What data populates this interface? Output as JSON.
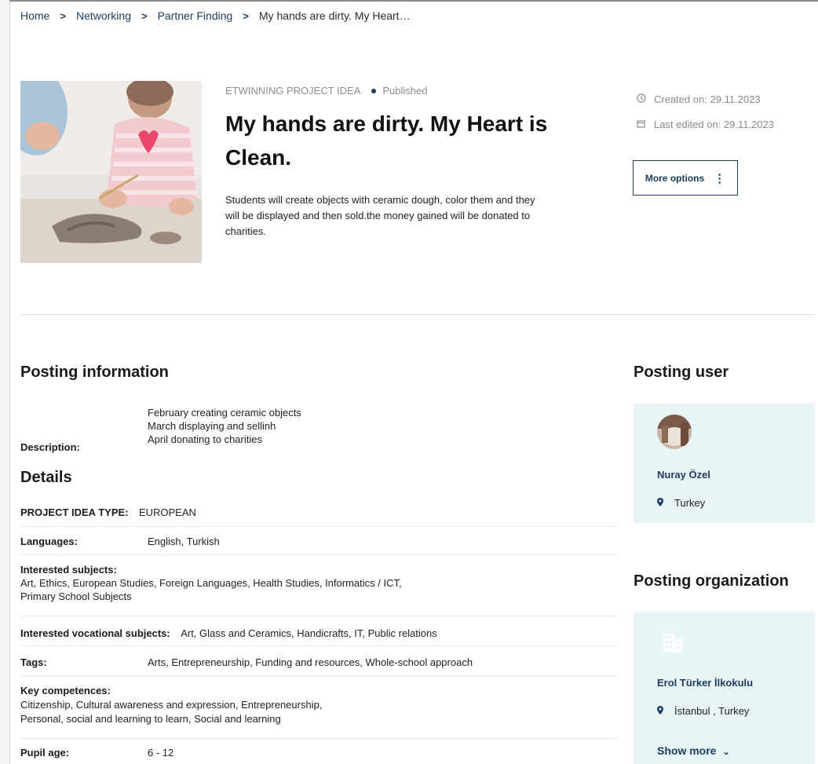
{
  "breadcrumb": {
    "items": [
      "Home",
      "Networking",
      "Partner Finding"
    ],
    "current": "My hands are dirty. My Heart…",
    "separator": ">"
  },
  "hero": {
    "kicker": "ETWINNING PROJECT IDEA",
    "status": "Published",
    "title": "My hands are dirty. My Heart is Clean.",
    "summary": "Students will create objects with ceramic dough, color them and they will be displayed and then sold.the money gained will be donated to charities."
  },
  "meta": {
    "created": "Created on: 29.11.2023",
    "edited": "Last edited on: 29.11.2023",
    "more_options": "More options"
  },
  "posting_info": {
    "heading": "Posting information",
    "description_label": "Description:",
    "description_lines": [
      "February creating ceramic objects",
      "March displaying and sellinh",
      "April donating to charities"
    ]
  },
  "details": {
    "heading": "Details",
    "project_idea_type_label": "PROJECT IDEA TYPE:",
    "project_idea_type": "EUROPEAN",
    "languages_label": "Languages:",
    "languages": "English, Turkish",
    "interested_subjects_label": "Interested subjects:",
    "interested_subjects_line1": "Art, Ethics, European Studies, Foreign Languages, Health Studies, Informatics / ICT,",
    "interested_subjects_line2": "Primary School Subjects",
    "vocational_label": "Interested vocational subjects:",
    "vocational": "Art, Glass and Ceramics, Handicrafts, IT, Public relations",
    "tags_label": "Tags:",
    "tags": "Arts, Entrepreneurship, Funding and resources, Whole-school approach",
    "key_competences_label": "Key competences:",
    "key_competences_line1": "Citizenship, Cultural awareness and expression, Entrepreneurship,",
    "key_competences_line2": "Personal, social and learning to learn, Social and learning",
    "pupil_age_label": "Pupil age:",
    "pupil_age": "6 - 12"
  },
  "posting_user": {
    "heading": "Posting user",
    "name": "Nuray Özel",
    "location": "Turkey"
  },
  "posting_org": {
    "heading": "Posting organization",
    "name": "Erol Türker İlkokulu",
    "location": "İstanbul , Turkey",
    "show_more": "Show more"
  },
  "colors": {
    "accent": "#1b3b5f",
    "card_bg": "#e9f4f7",
    "muted": "#8a8a8a"
  }
}
